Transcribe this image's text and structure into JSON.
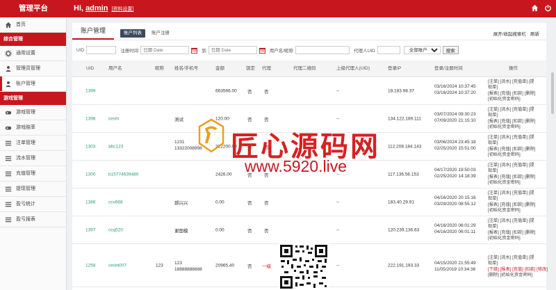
{
  "header": {
    "brand": "管理平台",
    "greeting": "Hi,",
    "username": "admin",
    "settings_link": "[资料设置]"
  },
  "sidebar": {
    "home": "首页",
    "section1": "综合管理",
    "general_settings": "通用设置",
    "admin_management": "管理员管理",
    "account_management": "账户管理",
    "section2": "游戏管理",
    "game_management": "游戏管理",
    "game_odds": "游戏赔率",
    "bet_management": "注单管理",
    "flow_management": "流水管理",
    "recharge_management": "充值管理",
    "withdraw_management": "提现管理",
    "profit_stats": "盈亏统计",
    "profit_report": "盈亏报表"
  },
  "page": {
    "title": "账户管理",
    "tab_list": "账户列表",
    "tab_register": "账户注册",
    "toggle_search": "展开/收起搜索栏",
    "refresh": "刷新"
  },
  "search": {
    "uid_label": "UID",
    "time_label": "注册时间",
    "date_from_placeholder": "日期 Date",
    "to_label": "到",
    "date_to_placeholder": "日期 Date",
    "username_label": "用户名/昵称",
    "agent_uid_label": "代理人UID",
    "type_selected": "全部账户",
    "search_button": "搜索"
  },
  "table": {
    "headers": {
      "uid": "UID",
      "username": "用户名",
      "nickname": "昵称",
      "name_phone": "姓名/手机号",
      "balance": "金额",
      "locked": "锁定",
      "agent": "代理",
      "agent_qr": "代理二维码",
      "parent_agent": "上级代理人(UID)",
      "login_ip": "登录IP",
      "login_reg_time": "登录/注册时间",
      "ops": "操作"
    },
    "rows": [
      {
        "uid": "1399",
        "username": "",
        "nickname": "",
        "name": "",
        "phone": "",
        "balance": "663566.00",
        "locked": "否",
        "agent": "否",
        "parent": "--",
        "ip": "18.183.98.37",
        "time1": "03/16/2024 10:37:45",
        "time2": "03/16/2024 10:37:20",
        "ops1": "[注单] [流水] [充值单] [提",
        "ops2": "现单]",
        "ops3": "[报表] [充值] [扣款] [删除]",
        "ops4": "[初始化资金密码]"
      },
      {
        "uid": "1398",
        "username": "ceshi",
        "nickname": "",
        "name": "测试",
        "phone": "",
        "balance": "120.00",
        "locked": "否",
        "agent": "否",
        "parent": "--",
        "ip": "134.122.189.111",
        "time1": "03/07/2024 09:30:23",
        "time2": "07/09/2020 21:15:10",
        "ops1": "[注单] [流水] [充值单] [提",
        "ops2": "现单]",
        "ops3": "[报表] [充值] [扣款] [删除]",
        "ops4": "[初始化资金密码]"
      },
      {
        "uid": "1303",
        "username": "abc123",
        "nickname": "",
        "name": "1231",
        "phone": "13322008998",
        "balance": "222200.00",
        "locked": "否",
        "agent": "否",
        "parent": "--",
        "ip": "112.208.184.143",
        "time1": "03/06/2024 23:45:18",
        "time2": "02/25/2020 15:51:00",
        "ops1": "[注单] [流水] [充值单] [提",
        "ops2": "现单]",
        "ops3": "[报表] [充值] [扣款] [删除]",
        "ops4": "[初始化资金密码]"
      },
      {
        "uid": "1300",
        "username": "b15774639480",
        "nickname": "",
        "name": "",
        "phone": "",
        "balance": "2426.00",
        "locked": "否",
        "agent": "否",
        "parent": "--",
        "ip": "117.136.56.153",
        "time1": "04/17/2020 19:50:03",
        "time2": "02/25/2020 14:18:39",
        "ops1": "[注单] [流水] [充值单] [提",
        "ops2": "现单]",
        "ops3": "[报表] [充值] [扣款] [删除]",
        "ops4": "[初始化资金密码]"
      },
      {
        "uid": "1386",
        "username": "ccv666",
        "nickname": "",
        "name": "郝兴兴",
        "phone": "",
        "balance": "0.00",
        "locked": "否",
        "agent": "否",
        "parent": "--",
        "ip": "183.40.29.91",
        "time1": "04/16/2020 20:15:16",
        "time2": "03/29/2020 08:55:12",
        "ops1": "[注单] [流水] [充值单] [提",
        "ops2": "现单]",
        "ops3": "[报表] [充值] [扣款] [删除]",
        "ops4": "[初始化资金密码]"
      },
      {
        "uid": "1397",
        "username": "ccq520",
        "nickname": "",
        "name": "谢国模",
        "phone": "",
        "balance": "0.00",
        "locked": "否",
        "agent": "否",
        "parent": "--",
        "ip": "120.239.136.63",
        "time1": "04/16/2020 06:01:29",
        "time2": "04/16/2020 06:01:11",
        "ops1": "[注单] [流水] [充值单] [提",
        "ops2": "现单]",
        "ops3": "[报表] [充值] [扣款] [删除]",
        "ops4": "[初始化资金密码]"
      },
      {
        "uid": "1258",
        "username": "ceshi007",
        "nickname": "123",
        "name": "123",
        "phone": "18888888888",
        "balance": "20965.40",
        "locked": "否",
        "agent": "一级",
        "parent": "--",
        "ip": "222.191.193.33",
        "time1": "04/15/2020 21:55:49",
        "time2": "11/05/2019 10:34:38",
        "ops0": "[注单] [流水] [充值单] [提",
        "ops1": "现单]",
        "ops2": "[下级] [报表] [充值] [扣款] [修改]",
        "ops3": "[删除] [初始化资金密码]",
        "ops4": ""
      }
    ]
  },
  "watermark": {
    "text": "匠心源码网",
    "url": "www.5920.live"
  },
  "colors": {
    "primary": "#c8161e",
    "uid_link": "#2a9b7e",
    "tab_active": "#3b4a5b"
  }
}
